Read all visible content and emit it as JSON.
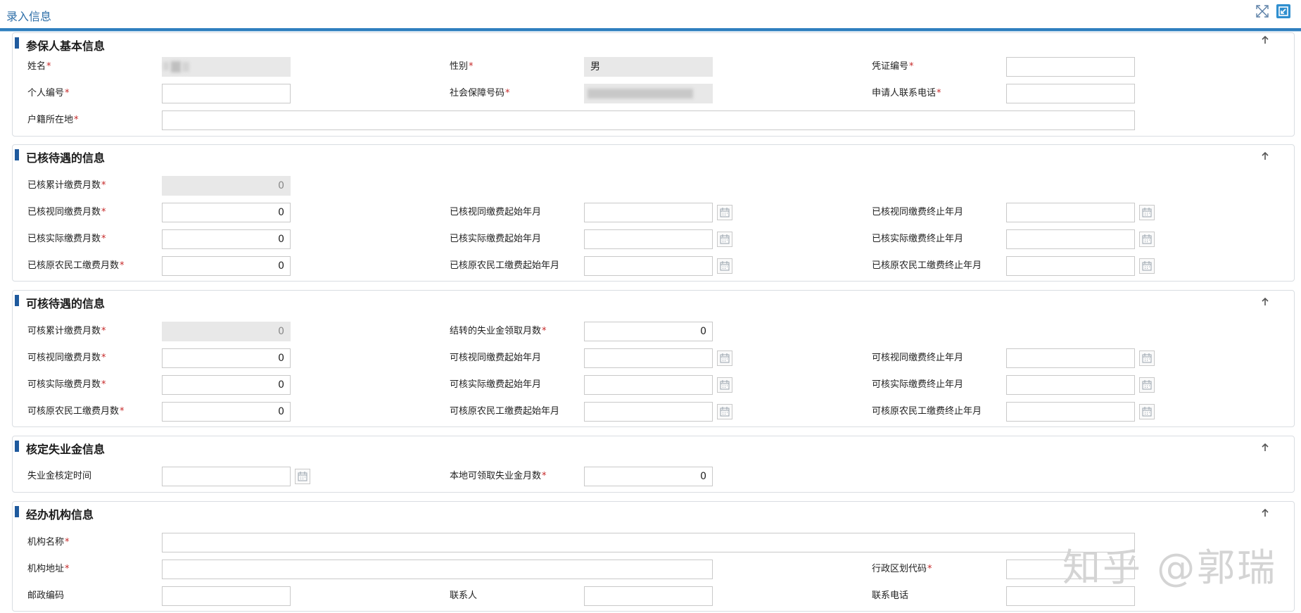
{
  "page": {
    "title": "录入信息"
  },
  "toolbar": {
    "fullscreen_icon": "fullscreen-icon",
    "exit_icon": "exit-icon"
  },
  "sections": {
    "basic": {
      "title": "参保人基本信息",
      "name": {
        "label": "姓名",
        "value": ""
      },
      "gender": {
        "label": "性别",
        "value": "男"
      },
      "voucher_no": {
        "label": "凭证编号",
        "value": ""
      },
      "personal_no": {
        "label": "个人编号",
        "value": ""
      },
      "ssn": {
        "label": "社会保障号码",
        "value": ""
      },
      "phone": {
        "label": "申请人联系电话",
        "value": ""
      },
      "domicile": {
        "label": "户籍所在地",
        "value": ""
      }
    },
    "approved": {
      "title": "已核待遇的信息",
      "total_months": {
        "label": "已核累计缴费月数",
        "value": "0"
      },
      "deemed_months": {
        "label": "已核视同缴费月数",
        "value": "0"
      },
      "deemed_start": {
        "label": "已核视同缴费起始年月",
        "value": ""
      },
      "deemed_end": {
        "label": "已核视同缴费终止年月",
        "value": ""
      },
      "actual_months": {
        "label": "已核实际缴费月数",
        "value": "0"
      },
      "actual_start": {
        "label": "已核实际缴费起始年月",
        "value": ""
      },
      "actual_end": {
        "label": "已核实际缴费终止年月",
        "value": ""
      },
      "migrant_months": {
        "label": "已核原农民工缴费月数",
        "value": "0"
      },
      "migrant_start": {
        "label": "已核原农民工缴费起始年月",
        "value": ""
      },
      "migrant_end": {
        "label": "已核原农民工缴费终止年月",
        "value": ""
      }
    },
    "eligible": {
      "title": "可核待遇的信息",
      "total_months": {
        "label": "可核累计缴费月数",
        "value": "0"
      },
      "carryover_months": {
        "label": "结转的失业金领取月数",
        "value": "0"
      },
      "deemed_months": {
        "label": "可核视同缴费月数",
        "value": "0"
      },
      "deemed_start": {
        "label": "可核视同缴费起始年月",
        "value": ""
      },
      "deemed_end": {
        "label": "可核视同缴费终止年月",
        "value": ""
      },
      "actual_months": {
        "label": "可核实际缴费月数",
        "value": "0"
      },
      "actual_start": {
        "label": "可核实际缴费起始年月",
        "value": ""
      },
      "actual_end": {
        "label": "可核实际缴费终止年月",
        "value": ""
      },
      "migrant_months": {
        "label": "可核原农民工缴费月数",
        "value": "0"
      },
      "migrant_start": {
        "label": "可核原农民工缴费起始年月",
        "value": ""
      },
      "migrant_end": {
        "label": "可核原农民工缴费终止年月",
        "value": ""
      }
    },
    "benefit": {
      "title": "核定失业金信息",
      "approval_date": {
        "label": "失业金核定时间",
        "value": ""
      },
      "local_months": {
        "label": "本地可领取失业金月数",
        "value": "0"
      }
    },
    "agency": {
      "title": "经办机构信息",
      "org_name": {
        "label": "机构名称",
        "value": ""
      },
      "org_address": {
        "label": "机构地址",
        "value": ""
      },
      "region_code": {
        "label": "行政区划代码",
        "value": ""
      },
      "postal_code": {
        "label": "邮政编码",
        "value": ""
      },
      "contact": {
        "label": "联系人",
        "value": ""
      },
      "contact_phone": {
        "label": "联系电话",
        "value": ""
      }
    }
  },
  "required_mark": "*",
  "collapse_icon": "arrow-up-icon",
  "calendar_icon": "calendar-icon",
  "watermark": "知乎 @郭瑞",
  "colors": {
    "accent": "#2f7fbf",
    "section_bar": "#1f5a9e",
    "required": "#c62828",
    "readonly_bg": "#e8e8e8"
  }
}
